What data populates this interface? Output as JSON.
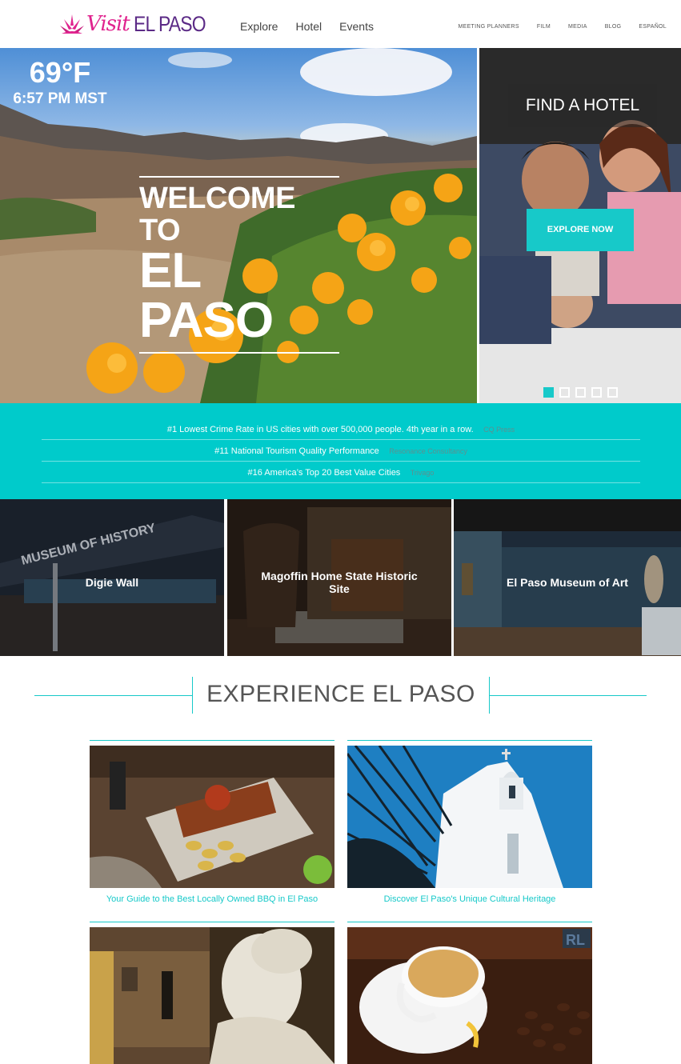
{
  "brand": {
    "visit": "Visit",
    "name": "EL PASO"
  },
  "nav": {
    "main": [
      "Explore",
      "Hotel",
      "Events"
    ],
    "utility": [
      "MEETING PLANNERS",
      "FILM",
      "MEDIA",
      "BLOG",
      "ESPAÑOL"
    ]
  },
  "weather": {
    "temp": "69°F",
    "time": "6:57 PM MST"
  },
  "hero": {
    "line1": "WELCOME TO",
    "line2": "EL PASO"
  },
  "hotel": {
    "title": "FIND A HOTEL",
    "button": "EXPLORE NOW",
    "slides_total": 5,
    "active_slide": 1
  },
  "accolades": [
    {
      "text": "#1 Lowest Crime Rate in US cities with over 500,000 people. 4th year in a row.",
      "source": "CQ Press"
    },
    {
      "text": "#11 National Tourism Quality Performance",
      "source": "Resonance Consultancy"
    },
    {
      "text": "#16 America’s Top 20 Best Value Cities",
      "source": "Trivago"
    }
  ],
  "attractions": [
    {
      "label": "Digie Wall",
      "sign": "MUSEUM OF HISTORY"
    },
    {
      "label": "Magoffin Home State Historic Site"
    },
    {
      "label": "El Paso Museum of Art"
    }
  ],
  "experience": {
    "title": "EXPERIENCE EL PASO",
    "cards": [
      {
        "caption": "Your Guide to the Best Locally Owned BBQ in El Paso"
      },
      {
        "caption": "Discover El Paso's Unique Cultural Heritage"
      },
      {
        "caption": ""
      },
      {
        "caption": "",
        "badge": "RL"
      }
    ]
  },
  "colors": {
    "accent": "#17c9c9",
    "band": "#00cbcb",
    "logo_pink": "#e0248f",
    "logo_purple": "#5b2a86"
  }
}
